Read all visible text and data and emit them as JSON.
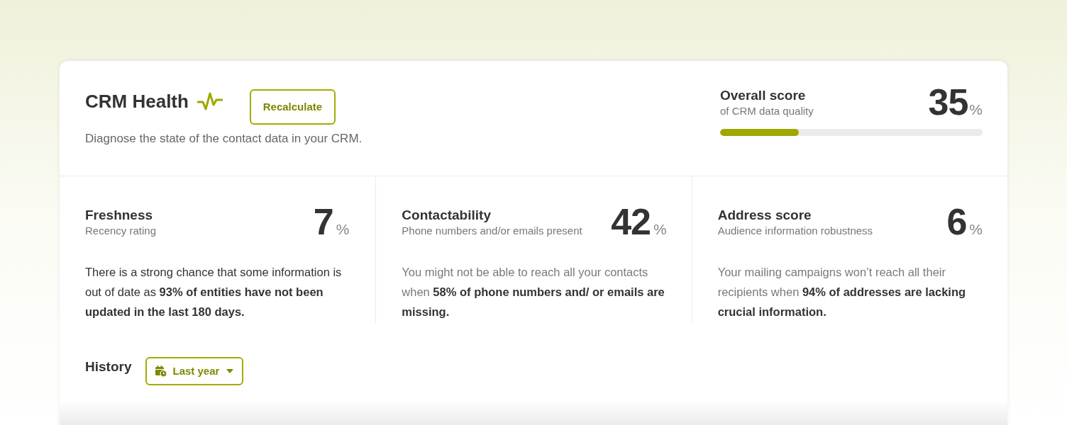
{
  "header": {
    "title": "CRM Health",
    "recalculate_button": "Recalculate",
    "description": "Diagnose the state of the contact data in your CRM."
  },
  "overall_score": {
    "title": "Overall score",
    "subtitle": "of CRM data quality",
    "value": "35",
    "unit": "%",
    "level": 0.3
  },
  "metrics": [
    {
      "title": "Freshness",
      "subtitle": "Recency rating",
      "value": "7",
      "unit": "%",
      "highlighted": true,
      "description": "There is a strong chance that some information is out of date as **93% of entities have not been updated in the last 180 days.**"
    },
    {
      "title": "Contactability",
      "subtitle": "Phone numbers and/or emails present",
      "value": "42",
      "unit": "%",
      "highlighted": false,
      "description": "You might not be able to reach all your contacts when **58% of phone numbers and/ or emails are missing.**"
    },
    {
      "title": "Address score",
      "subtitle": "Audience information robustness",
      "value": "6",
      "unit": "%",
      "highlighted": false,
      "description": "Your mailing campaigns won’t reach all their recipients when **94% of addresses are lacking crucial information.**"
    }
  ],
  "history": {
    "title": "History",
    "period_dropdown": {
      "label": "Last year"
    }
  }
}
